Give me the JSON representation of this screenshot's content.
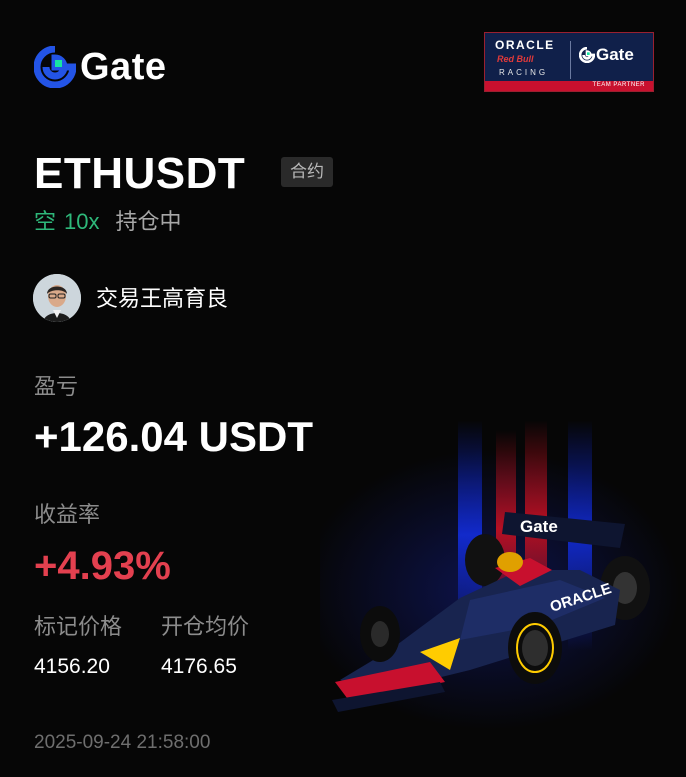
{
  "brand": {
    "name": "Gate"
  },
  "partner_badge": {
    "line1": "ORACLE",
    "line2": "Red Bull",
    "line3": "RACING",
    "brand": "Gate",
    "footer": "TEAM PARTNER"
  },
  "position": {
    "symbol": "ETHUSDT",
    "type_tag": "合约",
    "direction": "空",
    "leverage": "10x",
    "status": "持仓中"
  },
  "trader": {
    "name": "交易王高育良"
  },
  "pnl": {
    "label": "盈亏",
    "value": "+126.04 USDT"
  },
  "roi": {
    "label": "收益率",
    "value": "+4.93%"
  },
  "prices": {
    "mark_label": "标记价格",
    "mark_value": "4156.20",
    "entry_label": "开仓均价",
    "entry_value": "4176.65"
  },
  "timestamp": "2025-09-24 21:58:00",
  "colors": {
    "short": "#2eb87a",
    "profit_rate": "#e3404f",
    "muted": "#8c8c8c",
    "brand_blue": "#2354e6",
    "brand_green": "#17e6a1"
  }
}
